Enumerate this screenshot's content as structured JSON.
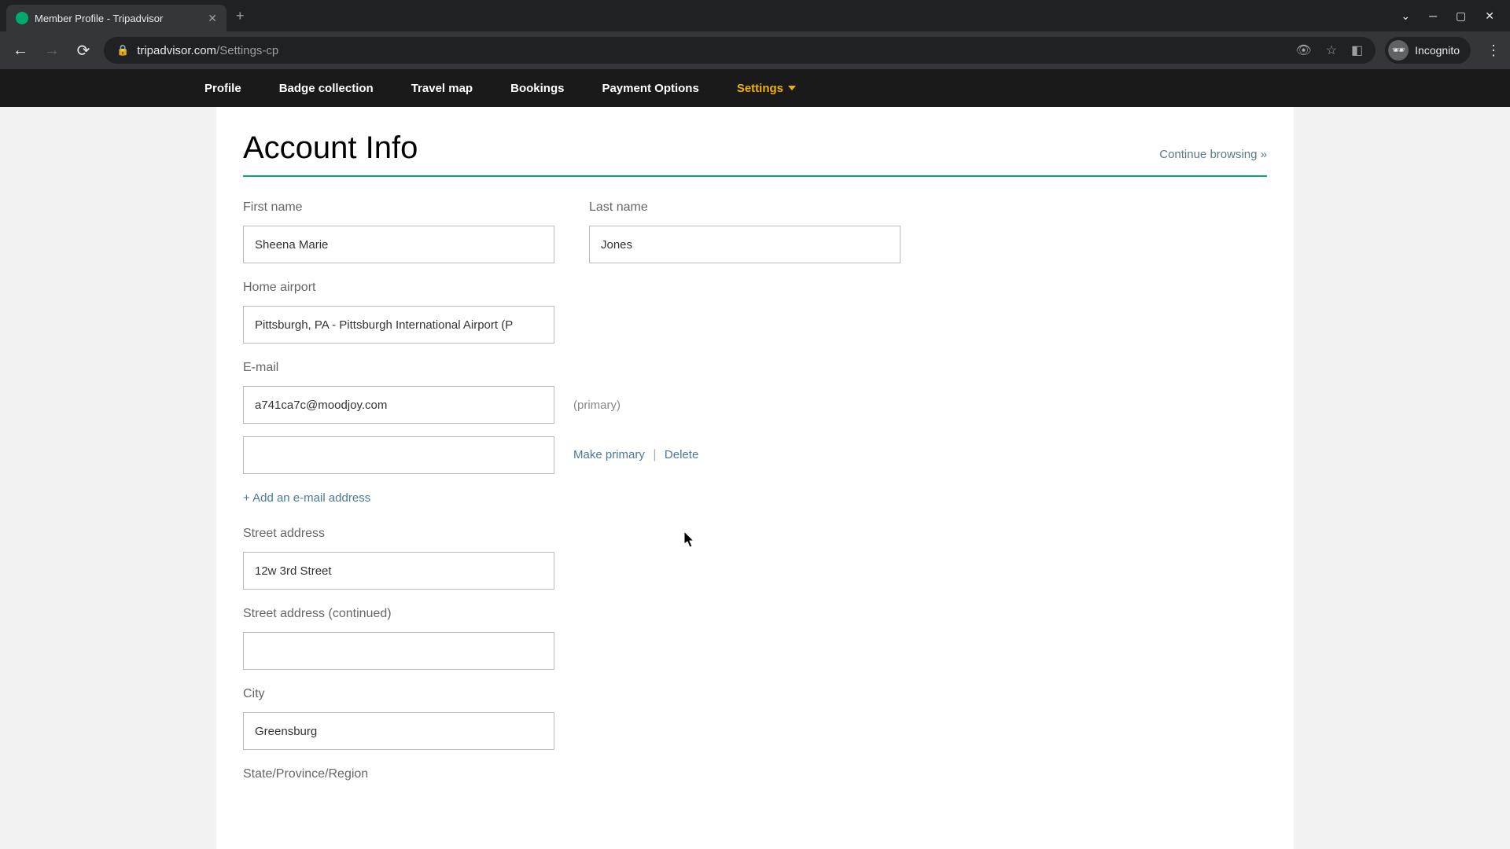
{
  "browser": {
    "tab_title": "Member Profile - Tripadvisor",
    "url_host": "tripadvisor.com",
    "url_path": "/Settings-cp",
    "incognito_label": "Incognito"
  },
  "nav": {
    "items": [
      "Profile",
      "Badge collection",
      "Travel map",
      "Bookings",
      "Payment Options",
      "Settings"
    ]
  },
  "page": {
    "title": "Account Info",
    "continue_browsing": "Continue browsing »"
  },
  "form": {
    "first_name_label": "First name",
    "first_name_value": "Sheena Marie",
    "last_name_label": "Last name",
    "last_name_value": "Jones",
    "home_airport_label": "Home airport",
    "home_airport_value": "Pittsburgh, PA - Pittsburgh International Airport (P",
    "email_label": "E-mail",
    "email_primary_value": "a741ca7c@moodjoy.com",
    "primary_text": "(primary)",
    "make_primary": "Make primary",
    "delete": "Delete",
    "add_email": "+ Add an e-mail address",
    "street_label": "Street address",
    "street_value": "12w 3rd Street",
    "street2_label": "Street address (continued)",
    "street2_value": "",
    "city_label": "City",
    "city_value": "Greensburg",
    "state_label": "State/Province/Region"
  }
}
